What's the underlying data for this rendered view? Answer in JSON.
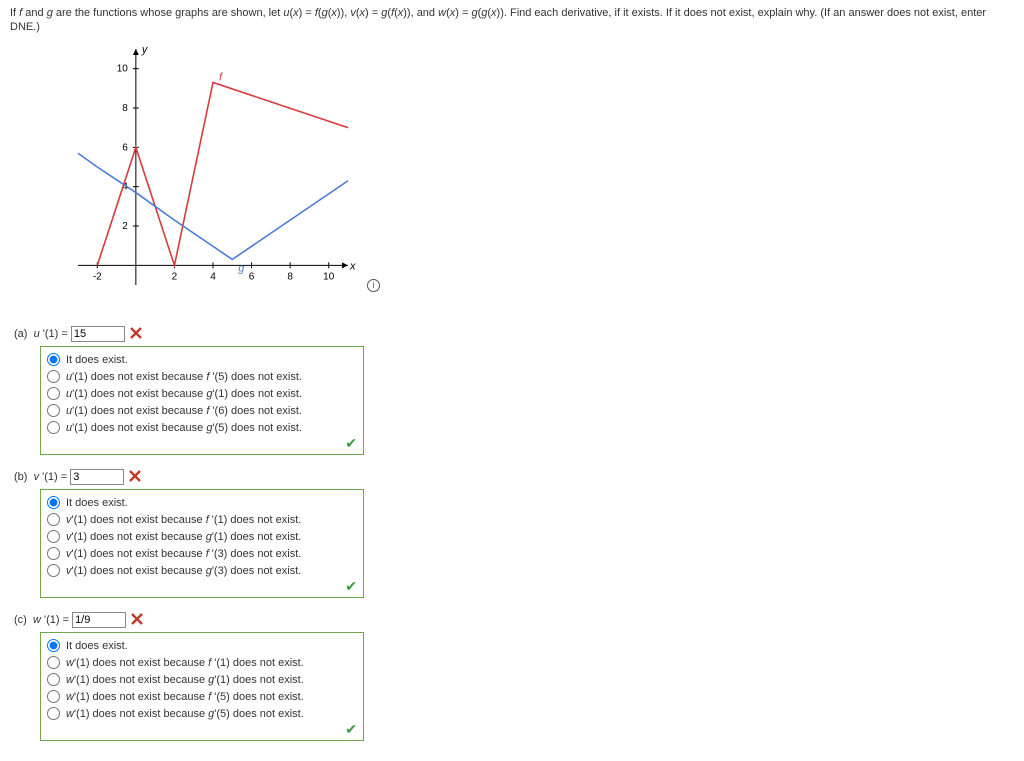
{
  "prompt_html": "If <em class='m'>f</em> and <em class='m'>g</em> are the functions whose graphs are shown, let <em class='m'>u</em>(<em class='m'>x</em>) = <em class='m'>f</em>(<em class='m'>g</em>(<em class='m'>x</em>)), <em class='m'>v</em>(<em class='m'>x</em>) = <em class='m'>g</em>(<em class='m'>f</em>(<em class='m'>x</em>)), and <em class='m'>w</em>(<em class='m'>x</em>) = <em class='m'>g</em>(<em class='m'>g</em>(<em class='m'>x</em>)). Find each derivative, if it exists. If it does not exist, explain why. (If an answer does not exist, enter DNE.)",
  "chart_data": {
    "type": "line",
    "xlabel": "x",
    "ylabel": "y",
    "xlim": [
      -3,
      11
    ],
    "ylim": [
      -1,
      11
    ],
    "xticks": [
      -2,
      2,
      4,
      6,
      8,
      10
    ],
    "yticks": [
      2,
      4,
      6,
      8,
      10
    ],
    "series": [
      {
        "name": "f",
        "color": "#d73c3c",
        "points": [
          [
            -2,
            0
          ],
          [
            0,
            6
          ],
          [
            2,
            0
          ],
          [
            4,
            9.3
          ],
          [
            11,
            7
          ]
        ]
      },
      {
        "name": "g",
        "color": "#4a7cd6",
        "points": [
          [
            -3,
            5.7
          ],
          [
            -2,
            5
          ],
          [
            0,
            3.7
          ],
          [
            2,
            2.3
          ],
          [
            5,
            0.3
          ],
          [
            11,
            4.3
          ]
        ]
      }
    ]
  },
  "parts": {
    "a": {
      "label": "(a)",
      "deriv_html": "<em class='m'>u</em>&nbsp;'(1) =",
      "value": "15",
      "options": [
        "It does exist.",
        "<em class='m'>u</em>'(1) does not exist because <em class='m'>f</em> '(5) does not exist.",
        "<em class='m'>u</em>'(1) does not exist because <em class='m'>g</em>'(1) does not exist.",
        "<em class='m'>u</em>'(1) does not exist because <em class='m'>f</em> '(6) does not exist.",
        "<em class='m'>u</em>'(1) does not exist because <em class='m'>g</em>'(5) does not exist."
      ],
      "selected": 0
    },
    "b": {
      "label": "(b)",
      "deriv_html": "<em class='m'>v</em>&nbsp;'(1) =",
      "value": "3",
      "options": [
        "It does exist.",
        "<em class='m'>v</em>'(1) does not exist because <em class='m'>f</em> '(1) does not exist.",
        "<em class='m'>v</em>'(1) does not exist because <em class='m'>g</em>'(1) does not exist.",
        "<em class='m'>v</em>'(1) does not exist because <em class='m'>f</em> '(3) does not exist.",
        "<em class='m'>v</em>'(1) does not exist because <em class='m'>g</em>'(3) does not exist."
      ],
      "selected": 0
    },
    "c": {
      "label": "(c)",
      "deriv_html": "<em class='m'>w</em>&nbsp;'(1) =",
      "value": "1/9",
      "options": [
        "It does exist.",
        "<em class='m'>w</em>'(1) does not exist because <em class='m'>f</em> '(1) does not exist.",
        "<em class='m'>w</em>'(1) does not exist because <em class='m'>g</em>'(1) does not exist.",
        "<em class='m'>w</em>'(1) does not exist because <em class='m'>f</em> '(5) does not exist.",
        "<em class='m'>w</em>'(1) does not exist because <em class='m'>g</em>'(5) does not exist."
      ],
      "selected": 0
    }
  },
  "icons": {
    "wrong_color": "#c0392b",
    "check_color": "#3a9a3a"
  }
}
